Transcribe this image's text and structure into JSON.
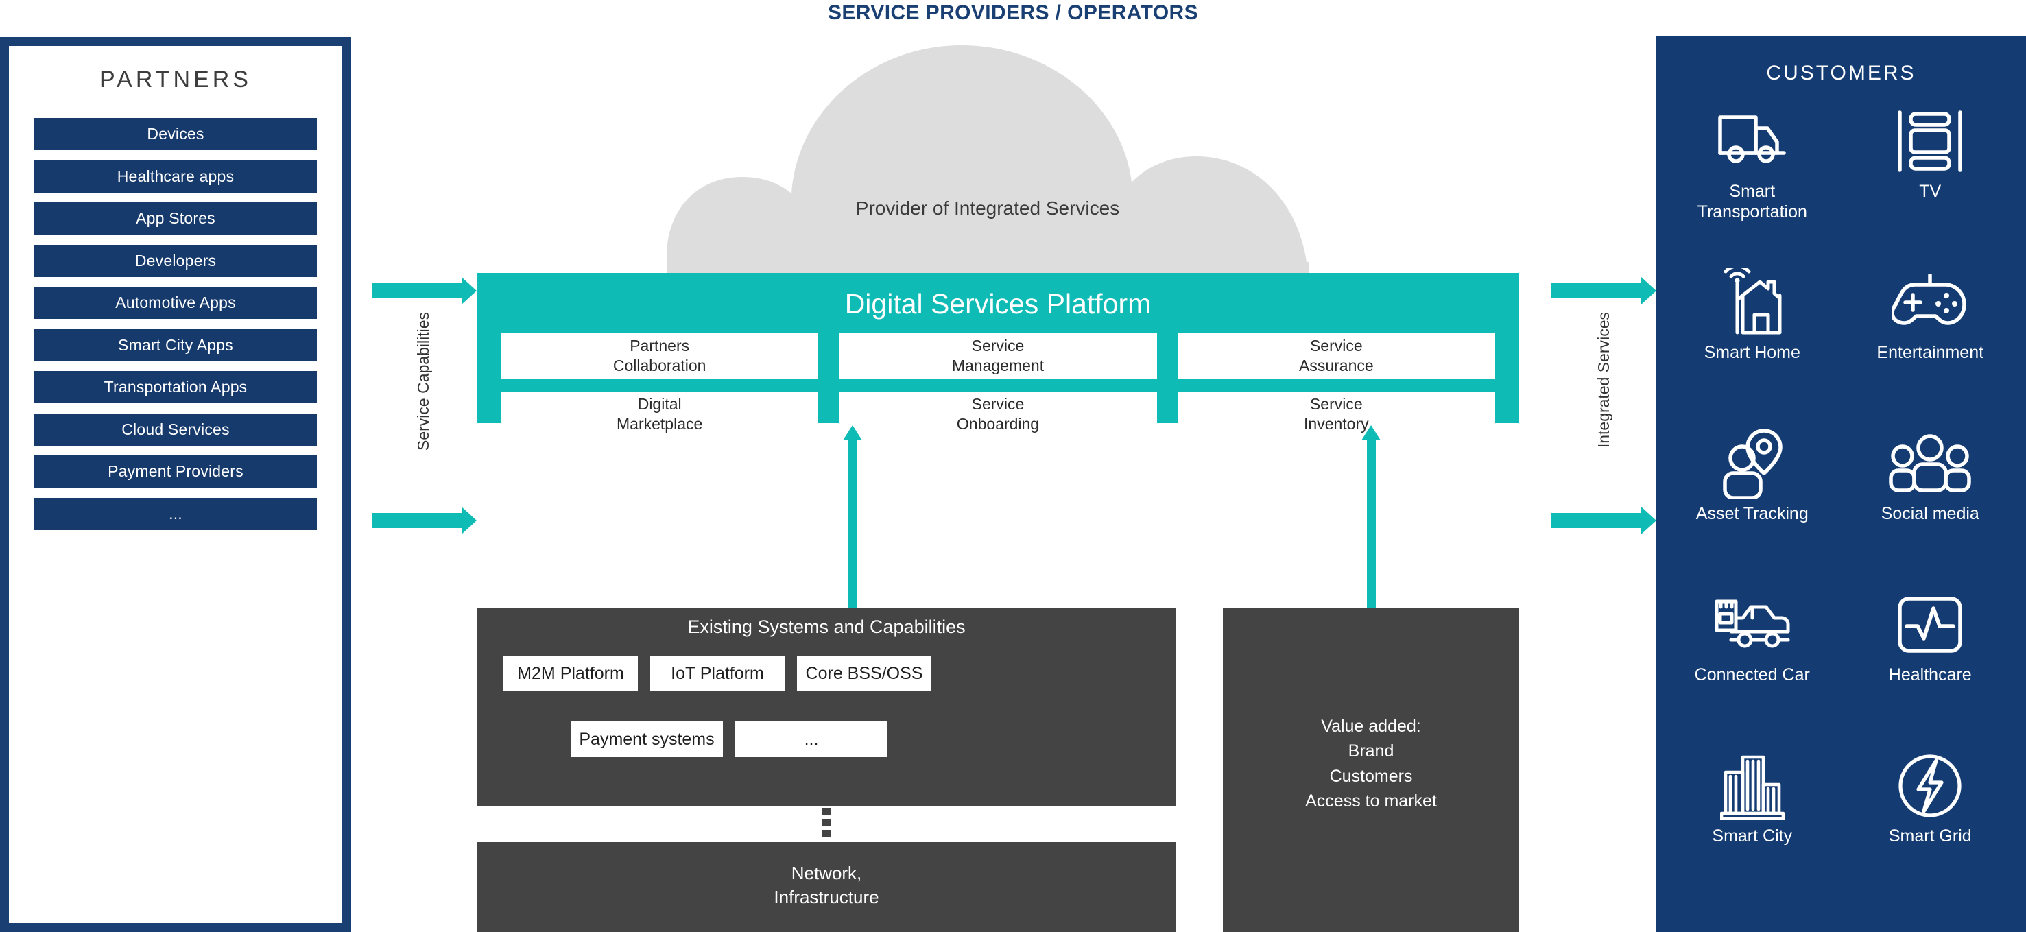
{
  "header": {
    "title": "SERVICE PROVIDERS / OPERATORS"
  },
  "partners": {
    "title": "PARTNERS",
    "items": [
      {
        "label": "Devices"
      },
      {
        "label": "Healthcare apps"
      },
      {
        "label": "App Stores"
      },
      {
        "label": "Developers"
      },
      {
        "label": "Automotive Apps"
      },
      {
        "label": "Smart City Apps"
      },
      {
        "label": "Transportation Apps"
      },
      {
        "label": "Cloud Services"
      },
      {
        "label": "Payment Providers"
      },
      {
        "label": "..."
      }
    ]
  },
  "cloud": {
    "label": "Provider of Integrated Services"
  },
  "platform": {
    "title": "Digital Services Platform",
    "cells": [
      {
        "line1": "Partners",
        "line2": "Collaboration"
      },
      {
        "line1": "Service",
        "line2": "Management"
      },
      {
        "line1": "Service",
        "line2": "Assurance"
      },
      {
        "line1": "Digital",
        "line2": "Marketplace"
      },
      {
        "line1": "Service",
        "line2": "Onboarding"
      },
      {
        "line1": "Service",
        "line2": "Inventory"
      }
    ]
  },
  "flows": {
    "inbound_label": "Service Capabilities",
    "outbound_label": "Integrated Services"
  },
  "existing": {
    "title": "Existing Systems and Capabilities",
    "row1": [
      {
        "label": "M2M Platform"
      },
      {
        "label": "IoT Platform"
      },
      {
        "label": "Core BSS/OSS"
      }
    ],
    "row2": [
      {
        "label": "Payment systems"
      },
      {
        "label": "..."
      }
    ]
  },
  "value_added": {
    "line1": "Value added:",
    "line2": "Brand",
    "line3": "Customers",
    "line4": "Access to market"
  },
  "network": {
    "line1": "Network,",
    "line2": "Infrastructure"
  },
  "customers": {
    "title": "CUSTOMERS",
    "items": [
      {
        "icon": "truck-icon",
        "line1": "Smart",
        "line2": "Transportation"
      },
      {
        "icon": "film-strip-icon",
        "line1": "TV",
        "line2": ""
      },
      {
        "icon": "smart-home-icon",
        "line1": "Smart Home",
        "line2": ""
      },
      {
        "icon": "gamepad-icon",
        "line1": "Entertainment",
        "line2": ""
      },
      {
        "icon": "map-pin-person-icon",
        "line1": "Asset Tracking",
        "line2": ""
      },
      {
        "icon": "people-group-icon",
        "line1": "Social media",
        "line2": ""
      },
      {
        "icon": "connected-car-icon",
        "line1": "Connected Car",
        "line2": ""
      },
      {
        "icon": "heartbeat-icon",
        "line1": "Healthcare",
        "line2": ""
      },
      {
        "icon": "buildings-icon",
        "line1": "Smart City",
        "line2": ""
      },
      {
        "icon": "bolt-circle-icon",
        "line1": "Smart Grid",
        "line2": ""
      }
    ]
  },
  "colors": {
    "navy": "#143C72",
    "navy_border": "#1A3F73",
    "teal": "#0EBBB5",
    "dark_gray": "#444444",
    "cloud_gray": "#DDDDDD"
  }
}
